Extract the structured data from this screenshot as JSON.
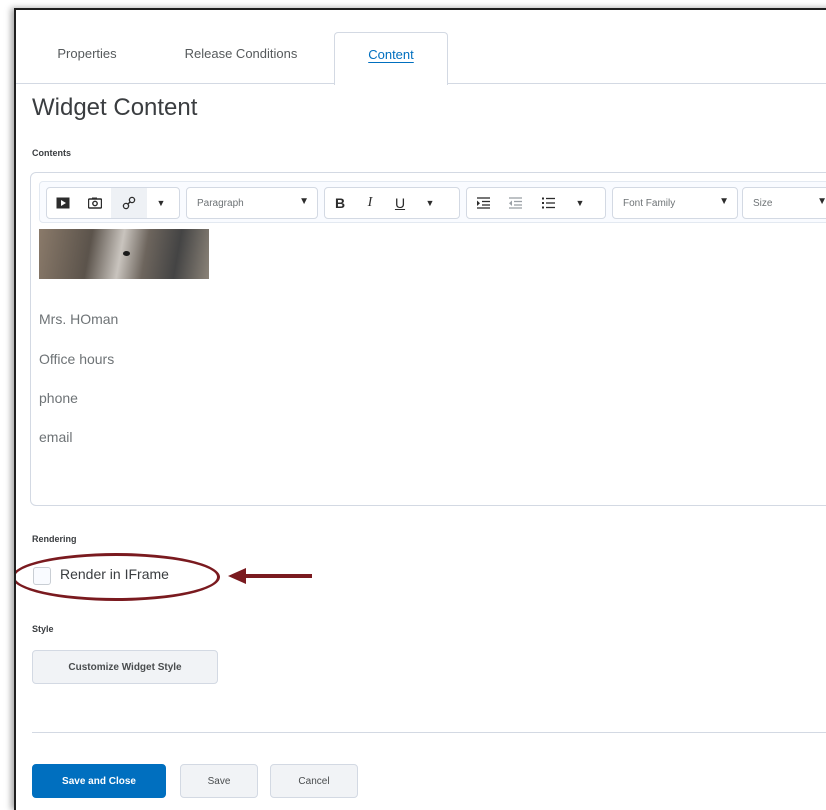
{
  "tabs": [
    {
      "label": "Properties"
    },
    {
      "label": "Release Conditions"
    },
    {
      "label": "Content"
    }
  ],
  "page_title": "Widget Content",
  "contents_label": "Contents",
  "toolbar": {
    "paragraph_select": "Paragraph",
    "bold": "B",
    "italic": "I",
    "underline": "U",
    "font_family_select": "Font Family",
    "size_select": "Size"
  },
  "editor_lines": [
    "Mrs. HOman",
    "Office hours",
    "phone",
    "email"
  ],
  "rendering": {
    "label": "Rendering",
    "checkbox_label": "Render in IFrame",
    "checked": false
  },
  "style": {
    "label": "Style",
    "button": "Customize Widget Style"
  },
  "footer": {
    "save_close": "Save and Close",
    "save": "Save",
    "cancel": "Cancel"
  },
  "colors": {
    "accent": "#006fbf",
    "annotation": "#7a1a1f"
  },
  "icons": [
    "video-icon",
    "camera-icon",
    "link-icon",
    "chevron-down-icon",
    "indent-icon",
    "outdent-icon",
    "list-icon"
  ]
}
